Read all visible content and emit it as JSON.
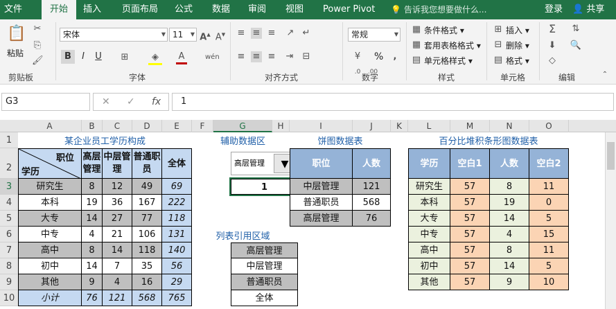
{
  "ribbon_tabs": [
    "文件",
    "开始",
    "插入",
    "页面布局",
    "公式",
    "数据",
    "审阅",
    "视图",
    "Power Pivot"
  ],
  "active_tab": "开始",
  "tell_me": "告诉我您想要做什么...",
  "login": "登录",
  "share": "共享",
  "clipboard": {
    "paste": "粘贴",
    "group": "剪贴板"
  },
  "font": {
    "name": "宋体",
    "size": "11",
    "group": "字体",
    "bold": "B",
    "italic": "I",
    "underline": "U"
  },
  "alignment": {
    "group": "对齐方式"
  },
  "number": {
    "format": "常规",
    "percent": "%",
    "group": "数字"
  },
  "styles": {
    "conditional": "条件格式",
    "table": "套用表格格式",
    "cell": "单元格样式",
    "group": "样式"
  },
  "cells": {
    "insert": "插入",
    "delete": "删除",
    "format": "格式",
    "group": "单元格"
  },
  "editing": {
    "group": "编辑"
  },
  "name_box": "G3",
  "formula_value": "1",
  "columns": [
    "A",
    "B",
    "C",
    "D",
    "E",
    "F",
    "G",
    "H",
    "I",
    "J",
    "K",
    "L",
    "M",
    "N",
    "O"
  ],
  "rows": [
    "1",
    "2",
    "3",
    "4",
    "5",
    "6",
    "7",
    "8",
    "9",
    "10"
  ],
  "table1": {
    "title": "某企业员工学历构成",
    "hdr_pos": "职位",
    "hdr_edu": "学历",
    "col_heads": [
      "高层管理",
      "中层管理",
      "普通职员",
      "全体"
    ],
    "rows": [
      [
        "研究生",
        "8",
        "12",
        "49",
        "69"
      ],
      [
        "本科",
        "19",
        "36",
        "167",
        "222"
      ],
      [
        "大专",
        "14",
        "27",
        "77",
        "118"
      ],
      [
        "中专",
        "4",
        "21",
        "106",
        "131"
      ],
      [
        "高中",
        "8",
        "14",
        "118",
        "140"
      ],
      [
        "初中",
        "14",
        "7",
        "35",
        "56"
      ],
      [
        "其他",
        "9",
        "4",
        "16",
        "29"
      ]
    ],
    "total": [
      "小计",
      "76",
      "121",
      "568",
      "765"
    ]
  },
  "helper": {
    "title": "辅助数据区",
    "dropdown": "高层管理",
    "index": "1",
    "list_title": "列表引用区域",
    "list": [
      "高层管理",
      "中层管理",
      "普通职员",
      "全体"
    ]
  },
  "pie": {
    "title": "饼图数据表",
    "headers": [
      "职位",
      "人数"
    ],
    "rows": [
      [
        "中层管理",
        "121"
      ],
      [
        "普通职员",
        "568"
      ],
      [
        "高层管理",
        "76"
      ]
    ]
  },
  "stack": {
    "title": "百分比堆积条形图数据表",
    "headers": [
      "学历",
      "空白1",
      "人数",
      "空白2"
    ],
    "rows": [
      [
        "研究生",
        "57",
        "8",
        "11"
      ],
      [
        "本科",
        "57",
        "19",
        "0"
      ],
      [
        "大专",
        "57",
        "14",
        "5"
      ],
      [
        "中专",
        "57",
        "4",
        "15"
      ],
      [
        "高中",
        "57",
        "8",
        "11"
      ],
      [
        "初中",
        "57",
        "14",
        "5"
      ],
      [
        "其他",
        "57",
        "9",
        "10"
      ]
    ]
  },
  "colors": {
    "excel_green": "#217346",
    "header_blue": "#c5d9f1",
    "gray_row": "#bfbfbf",
    "orange": "#fbd4b4",
    "light_green": "#ebf1de",
    "title_blue": "#1f5fa8"
  }
}
